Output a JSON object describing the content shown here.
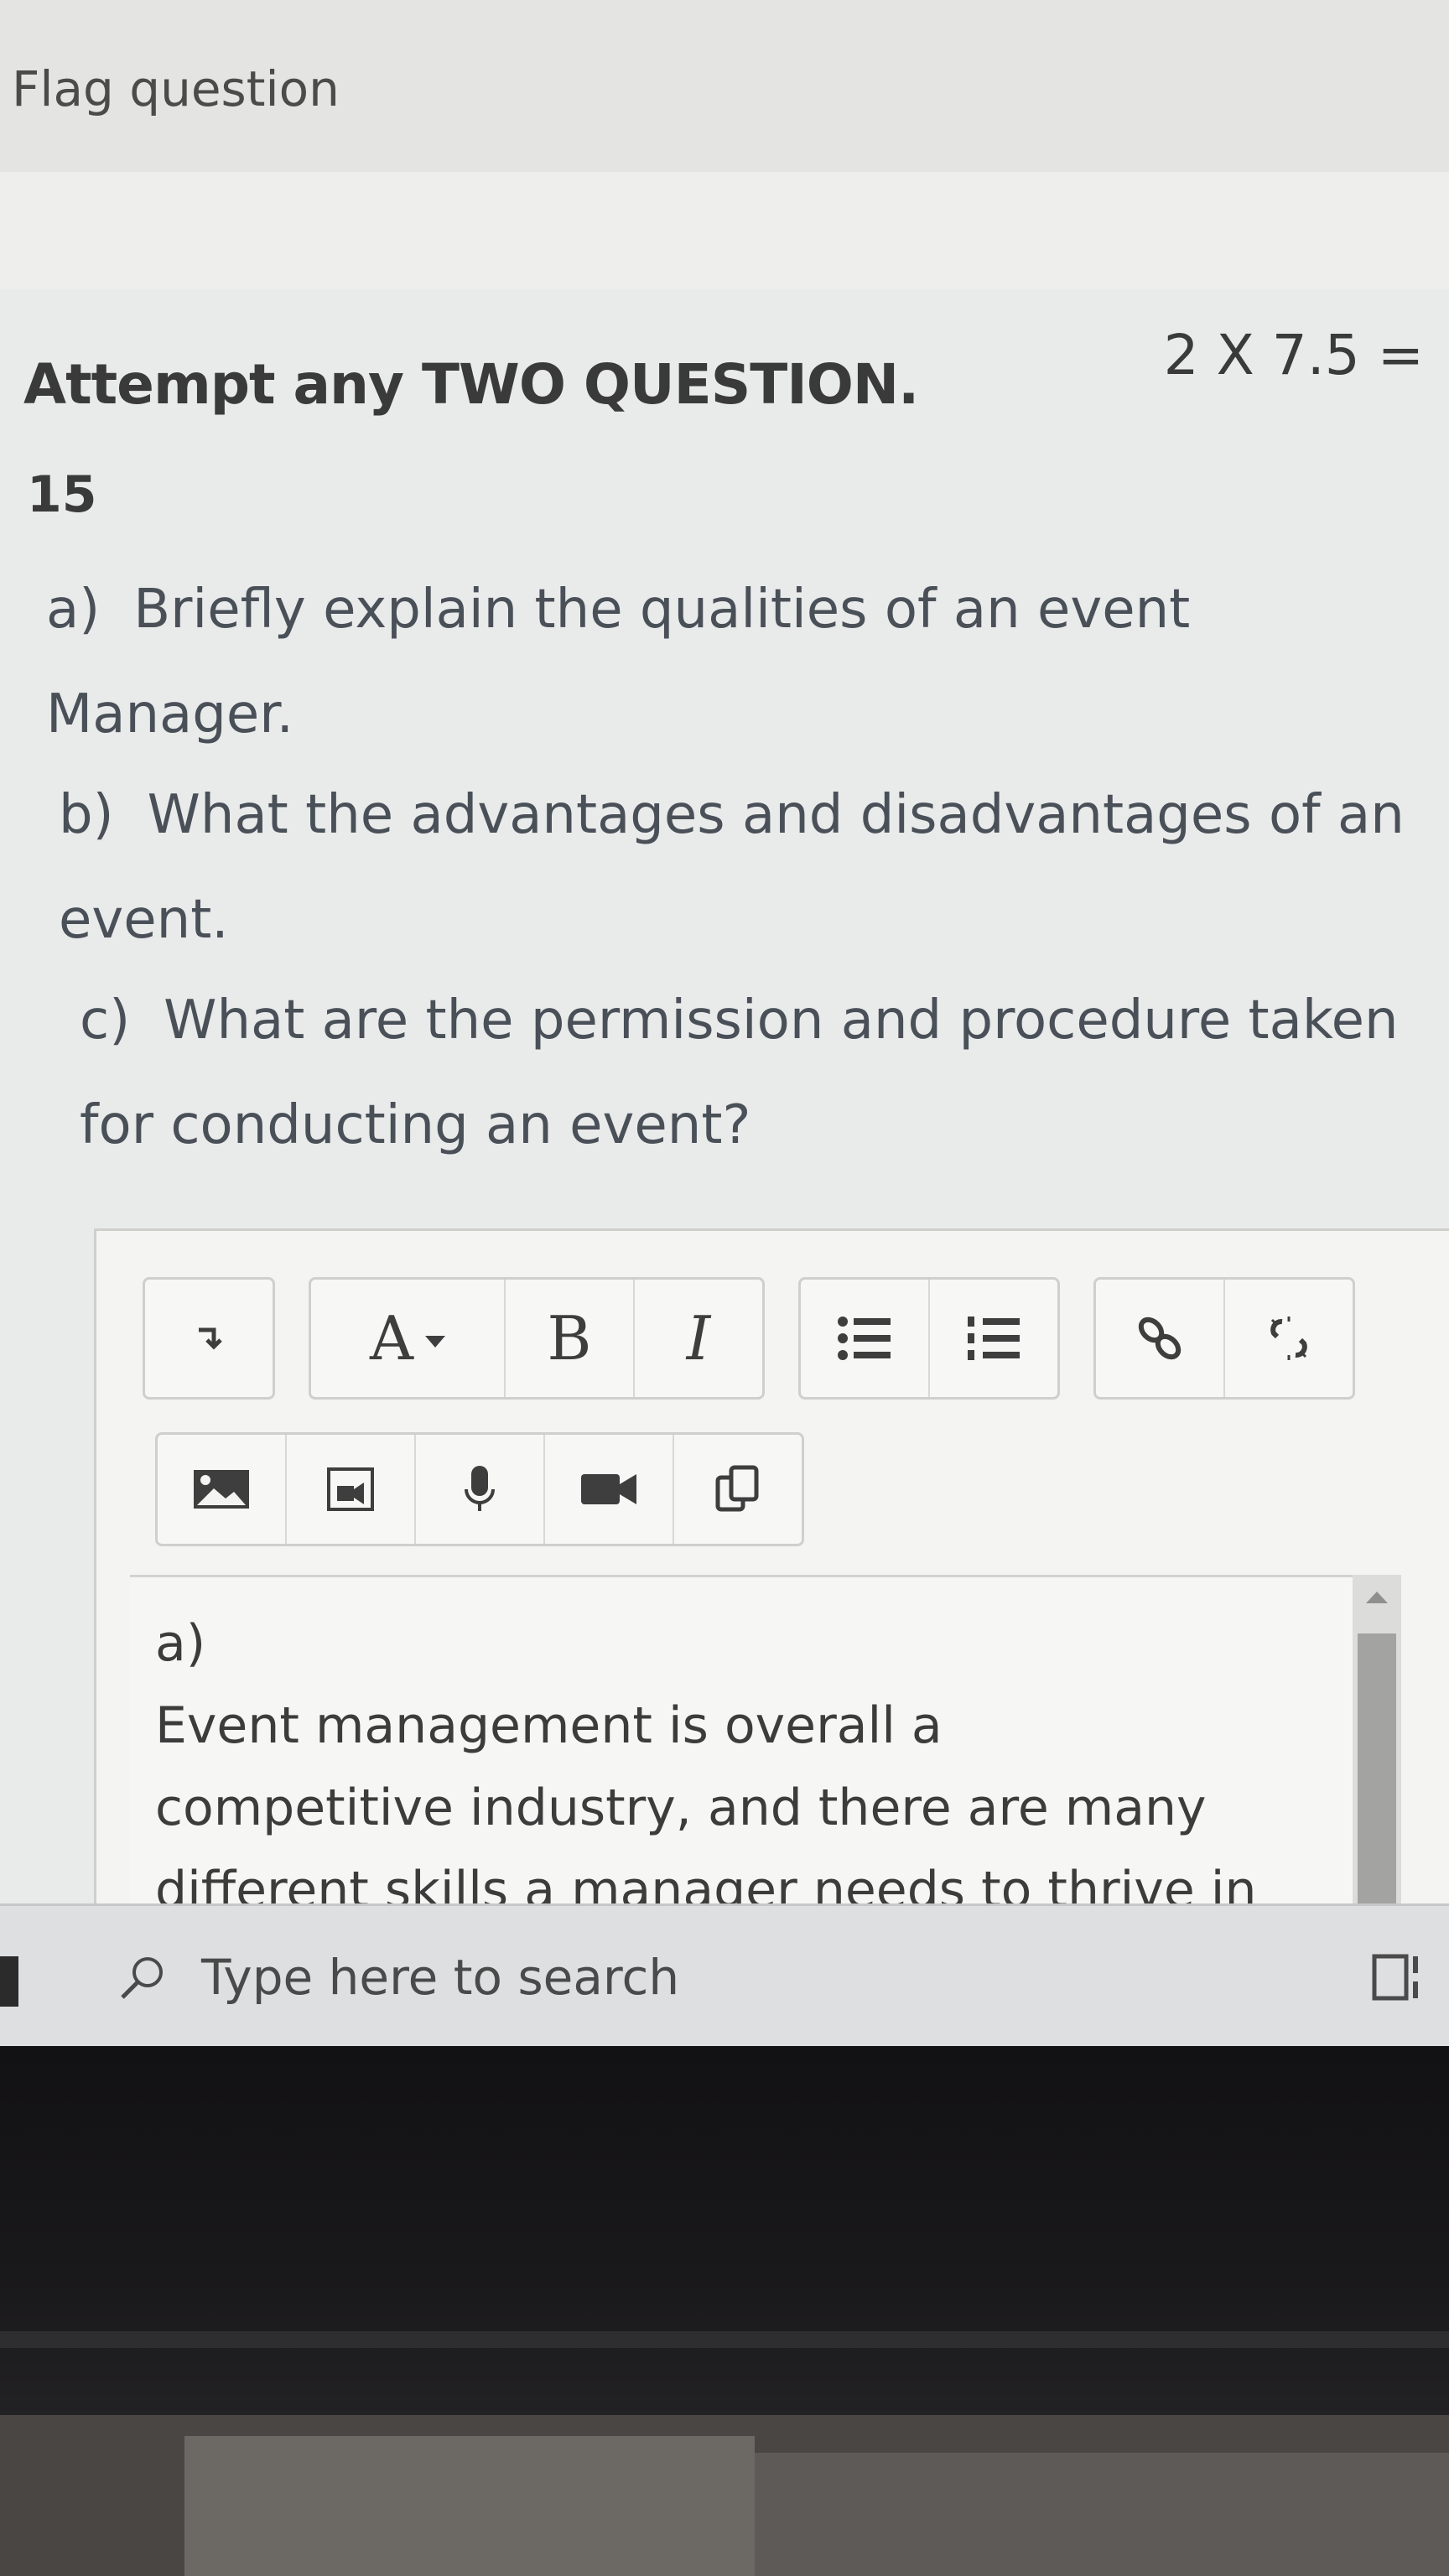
{
  "flag": {
    "label": "Flag question"
  },
  "question": {
    "header": "Attempt any TWO QUESTION.",
    "marks": "2 X 7.5 =",
    "total": "15",
    "items": [
      {
        "letter": "a)",
        "text": "Briefly explain the qualities of an event Manager."
      },
      {
        "letter": "b)",
        "text": "What the advantages and disadvantages of an event."
      },
      {
        "letter": "c)",
        "text": "What are the permission and procedure taken for conducting an event?"
      }
    ]
  },
  "editor": {
    "toolbar": {
      "toggle_icon": "toolbar-toggle-icon",
      "font_label": "A",
      "bold_label": "B",
      "italic_label": "I",
      "icons": [
        "unordered-list-icon",
        "ordered-list-icon",
        "link-icon",
        "unlink-icon",
        "image-icon",
        "media-icon",
        "microphone-icon",
        "video-camera-icon",
        "copy-icon"
      ]
    },
    "content": {
      "line1": "a)",
      "line2": "Event management is overall a",
      "line3": "competitive industry, and there are many",
      "line4": "different skills a manager needs to thrive in"
    }
  },
  "taskbar": {
    "search_placeholder": "Type here to search"
  }
}
